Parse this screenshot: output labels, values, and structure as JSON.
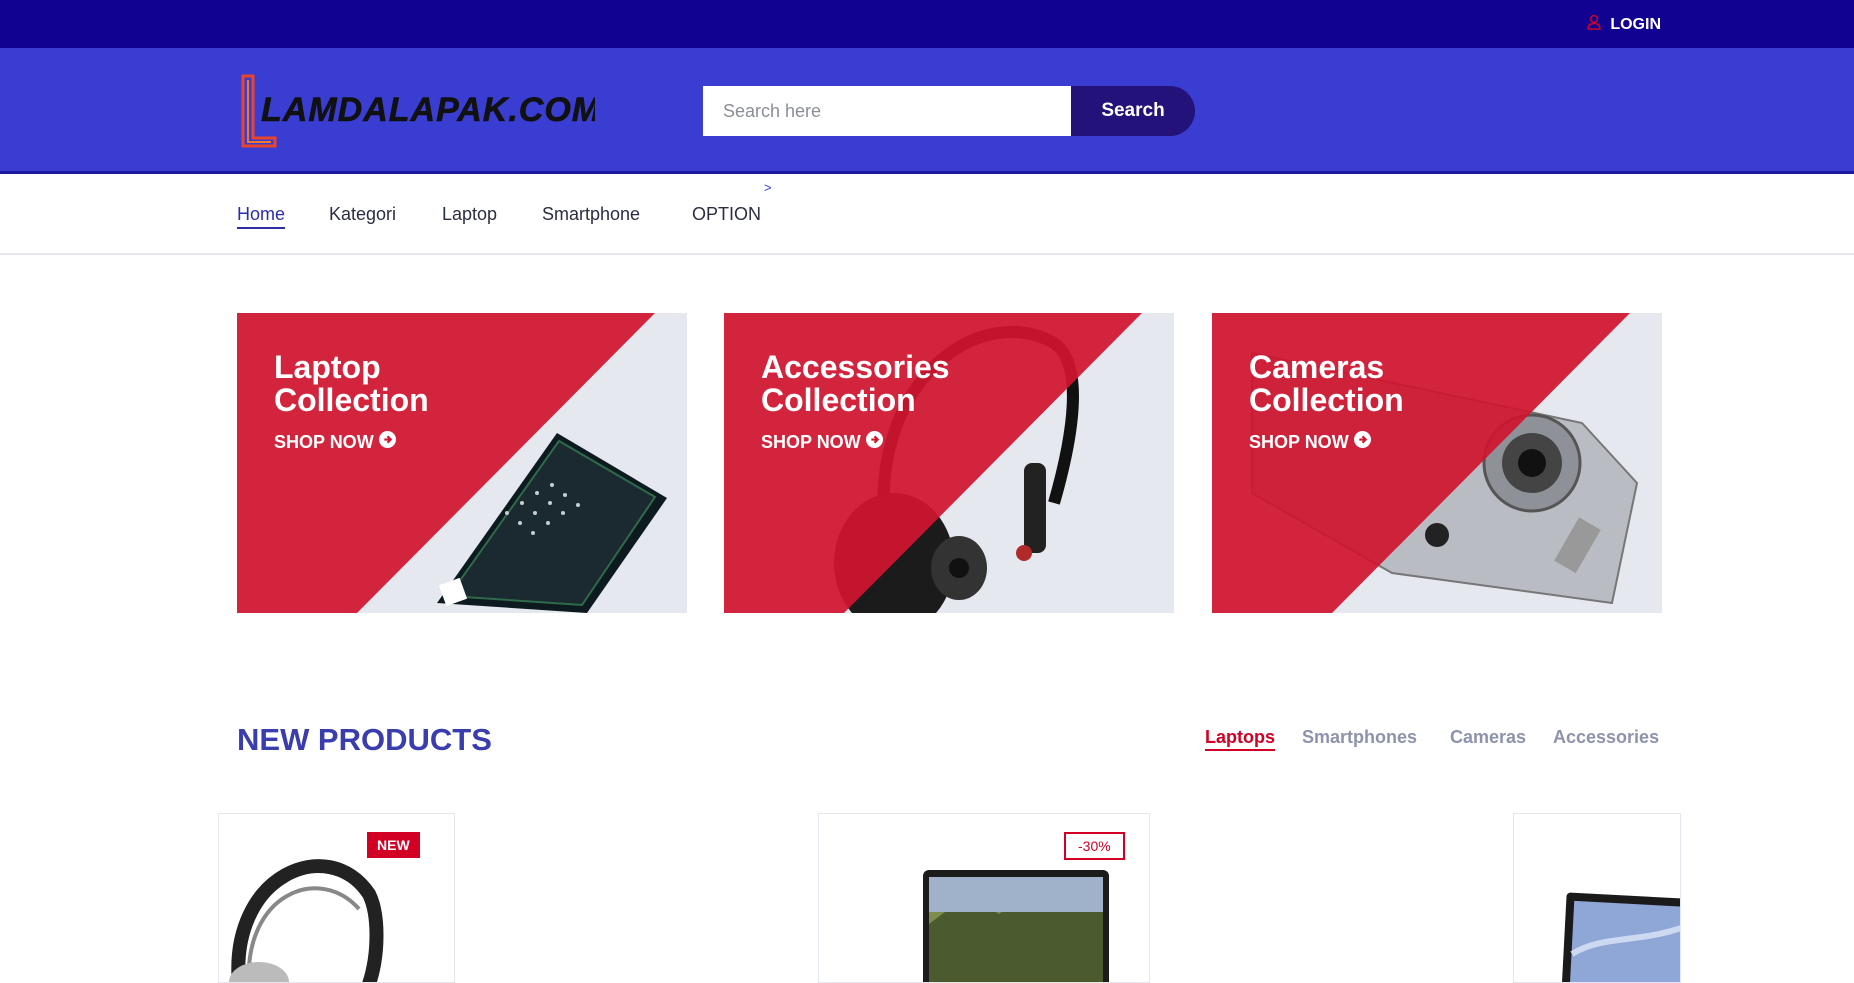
{
  "topbar": {
    "login_label": "LOGIN"
  },
  "header": {
    "logo_text": "LAMDALAPAK.COM",
    "search_placeholder": "Search here",
    "search_button": "Search"
  },
  "nav": {
    "items": [
      {
        "label": "Home",
        "active": true
      },
      {
        "label": "Kategori"
      },
      {
        "label": "Laptop"
      },
      {
        "label": "Smartphone"
      },
      {
        "label": "OPTION"
      }
    ],
    "submenu_indicator": ">"
  },
  "collections": [
    {
      "title_line1": "Laptop",
      "title_line2": "Collection",
      "cta": "SHOP NOW"
    },
    {
      "title_line1": "Accessories",
      "title_line2": "Collection",
      "cta": "SHOP NOW"
    },
    {
      "title_line1": "Cameras",
      "title_line2": "Collection",
      "cta": "SHOP NOW"
    }
  ],
  "new_products": {
    "title": "NEW PRODUCTS",
    "tabs": [
      {
        "label": "Laptops",
        "active": true
      },
      {
        "label": "Smartphones"
      },
      {
        "label": "Cameras"
      },
      {
        "label": "Accessories"
      }
    ],
    "products": [
      {
        "badge": "NEW",
        "image": "headphones"
      },
      {
        "badge": "-30%",
        "image": "laptop"
      },
      {
        "image": "tablet"
      }
    ]
  },
  "colors": {
    "topbar": "#120291",
    "header": "#3a3dd1",
    "search_button": "#22127a",
    "accent_red": "#d10024",
    "nav_active": "#2c2da8"
  }
}
